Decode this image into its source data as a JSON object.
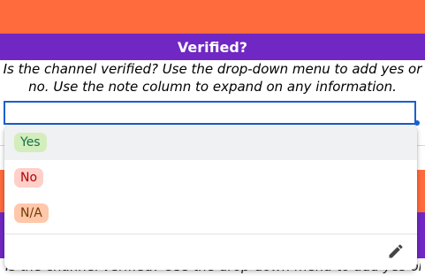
{
  "sheet": {
    "header_title": "Verified?",
    "description": "Is the channel verified? Use the drop-down menu to add yes or no. Use the note column to expand on any information.",
    "bottom_description": "Is the channel verified? Use the drop-down menu to add yes or"
  },
  "dropdown": {
    "options": [
      {
        "label": "Yes",
        "bg": "#d4edbc",
        "fg": "#11734b"
      },
      {
        "label": "No",
        "bg": "#ffcfc9",
        "fg": "#b10202"
      },
      {
        "label": "N/A",
        "bg": "#ffc8aa",
        "fg": "#753800"
      }
    ],
    "edit_icon": "pencil-icon"
  },
  "colors": {
    "orange": "#ff6b3d",
    "purple": "#7127c4",
    "selection": "#1a5fd0"
  }
}
